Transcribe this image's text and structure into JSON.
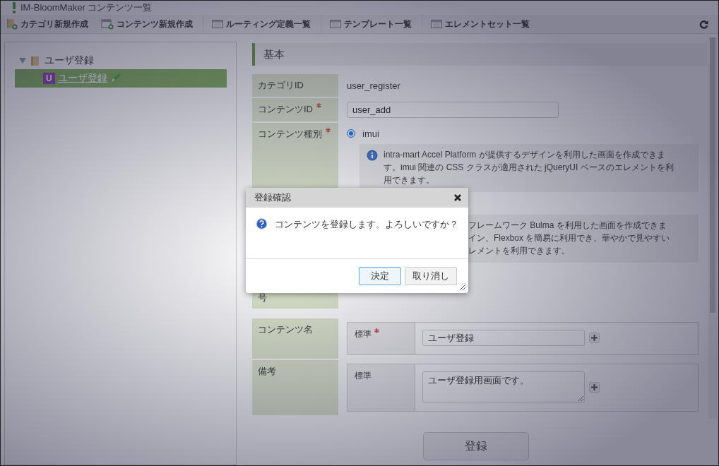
{
  "window": {
    "title": "IM-BloomMaker コンテンツ一覧"
  },
  "toolbar": [
    {
      "label": "カテゴリ新規作成",
      "kind": "new-category"
    },
    {
      "label": "コンテンツ新規作成",
      "kind": "new-content"
    },
    {
      "label": "ルーティング定義一覧",
      "kind": "list"
    },
    {
      "label": "テンプレート一覧",
      "kind": "list"
    },
    {
      "label": "エレメントセット一覧",
      "kind": "list"
    }
  ],
  "tree": [
    {
      "label": "ユーザ登録",
      "expanded": true,
      "children": [
        {
          "label": "ユーザ登録",
          "badge": "U",
          "selected": true
        }
      ]
    }
  ],
  "section": {
    "title": "基本"
  },
  "category_id": {
    "label": "カテゴリID",
    "value": "user_register"
  },
  "content_id": {
    "label": "コンテンツID",
    "required": true,
    "value": "user_add"
  },
  "content_type": {
    "label": "コンテンツ種別",
    "required": true,
    "options": [
      {
        "label": "imui",
        "selected": true,
        "description": "intra-mart Accel Platform が提供するデザインを利用した画面を作成できます。imui 関連の CSS クラスが適用された jQueryUI ベースのエレメントを利用できます。"
      }
    ],
    "partial_description": [
      "フレームワーク Bulma を利用した画面を作成できま",
      "イン、Flexbox を簡易に利用でき、華やかで見やすい",
      "レメントを利用できます。"
    ]
  },
  "partial_row_label": "号",
  "content_name": {
    "label": "コンテンツ名",
    "entries": [
      {
        "label": "標準",
        "required": true,
        "value": "ユーザ登録",
        "multiline": false
      }
    ]
  },
  "remarks": {
    "label": "備考",
    "entries": [
      {
        "label": "標準",
        "required": false,
        "value": "ユーザ登録用画面です。",
        "multiline": true
      }
    ]
  },
  "submit": {
    "label": "登録"
  },
  "dialog": {
    "title": "登録確認",
    "message": "コンテンツを登録します。よろしいですか？",
    "buttons": [
      {
        "label": "決定",
        "focused": true
      },
      {
        "label": "取り消し",
        "focused": false
      }
    ]
  }
}
